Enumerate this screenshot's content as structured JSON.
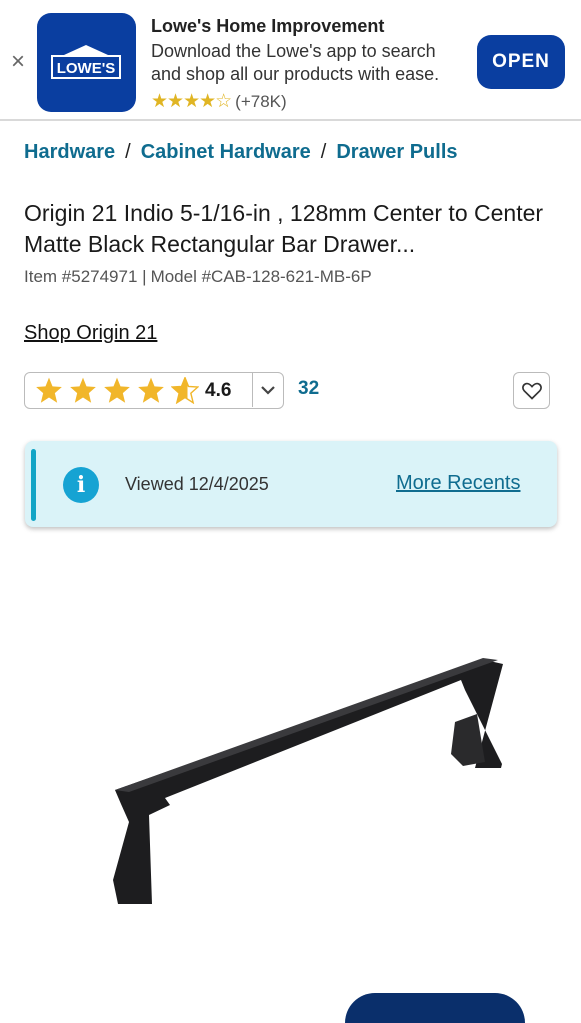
{
  "banner": {
    "close_glyph": "×",
    "logo_text": "LOWE'S",
    "title": "Lowe's Home Improvement",
    "description": "Download the Lowe's app to search and shop all our products with ease.",
    "stars": "★★★★☆",
    "rating_count": "(+78K)",
    "open_label": "OPEN",
    "brand_color": "#0a3ea0"
  },
  "breadcrumb": {
    "items": [
      "Hardware",
      "Cabinet Hardware",
      "Drawer Pulls"
    ],
    "separator": "/"
  },
  "product": {
    "title": "Origin 21 Indio 5-1/16-in , 128mm Center to Center Matte Black Rectangular Bar Drawer...",
    "item_number": "Item #5274971 |",
    "model_number": "Model #CAB-128-621-MB-6P",
    "shop_link": "Shop Origin 21"
  },
  "rating": {
    "value": "4.6",
    "stars_fraction": 0.92,
    "review_count": "32",
    "star_color": "#f1b62a"
  },
  "viewed": {
    "text": "Viewed 12/4/2025",
    "link_label": "More Recents",
    "info_glyph": "i"
  },
  "icons": {
    "close": "close-icon",
    "chevron": "chevron-down-icon",
    "favorite": "heart-icon",
    "info": "info-icon"
  }
}
